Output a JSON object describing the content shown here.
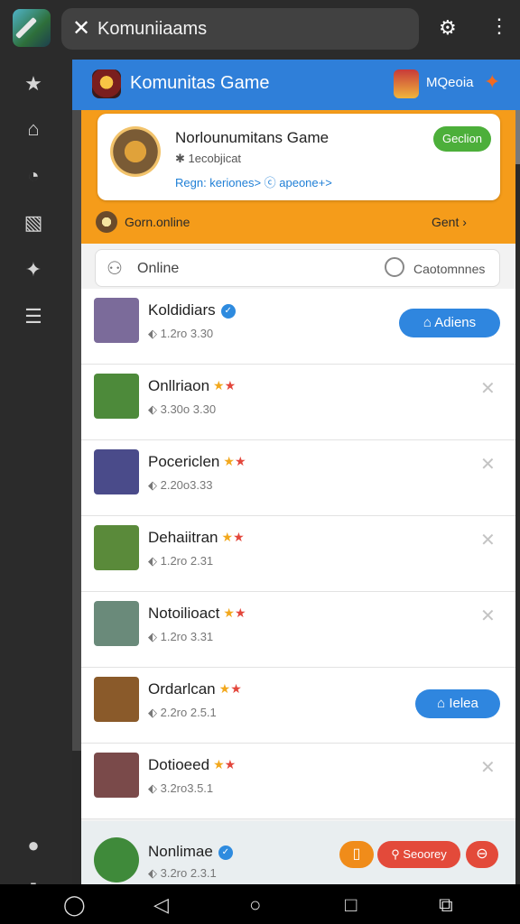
{
  "topbar": {
    "title": "Komuniiaams",
    "close_glyph": "✕"
  },
  "sidebar": {
    "icons": [
      "star-icon",
      "home-icon",
      "compass-icon",
      "image-icon",
      "pin-icon",
      "list-icon",
      "people-icon",
      "square-icon"
    ]
  },
  "header": {
    "title": "Komunitas Game",
    "user": "MQeoia"
  },
  "community": {
    "title": "Norlounumitans Game",
    "subtitle": "✱ 1ecobjicat",
    "links": "Regn: keriones> ⓒ apeone+>",
    "button": "Geclion"
  },
  "online_bar": {
    "label": "Gorn.online",
    "right": "Gent"
  },
  "filter": {
    "left": "Online",
    "right": "Caotomnnes"
  },
  "players": [
    {
      "name": "Koldidiars",
      "meta": "1.2ro 3.30",
      "verified": true,
      "stars": false,
      "action": "Adiens",
      "color": "#7b6b9a"
    },
    {
      "name": "Onllriaon",
      "meta": "3.30o 3.30",
      "verified": false,
      "stars": true,
      "action": "",
      "color": "#4d8a3a"
    },
    {
      "name": "Pocericlen",
      "meta": "2.20o3.33",
      "verified": false,
      "stars": true,
      "action": "",
      "color": "#4a4b8a"
    },
    {
      "name": "Dehaiitran",
      "meta": "1.2ro 2.31",
      "verified": false,
      "stars": true,
      "action": "",
      "color": "#5a8a3a"
    },
    {
      "name": "Notoilioact",
      "meta": "1.2ro 3.31",
      "verified": false,
      "stars": true,
      "action": "",
      "color": "#6a8a7a"
    },
    {
      "name": "Ordarlcan",
      "meta": "2.2ro 2.5.1",
      "verified": false,
      "stars": true,
      "action": "Ielea",
      "color": "#8a5a2a"
    },
    {
      "name": "Dotioeed",
      "meta": "3.2ro3.5.1",
      "verified": false,
      "stars": true,
      "action": "",
      "color": "#7a4a4a"
    }
  ],
  "last_player": {
    "name": "Nonlimae",
    "meta": "3.2ro 2.3.1",
    "button_mid": "Seoorey"
  }
}
